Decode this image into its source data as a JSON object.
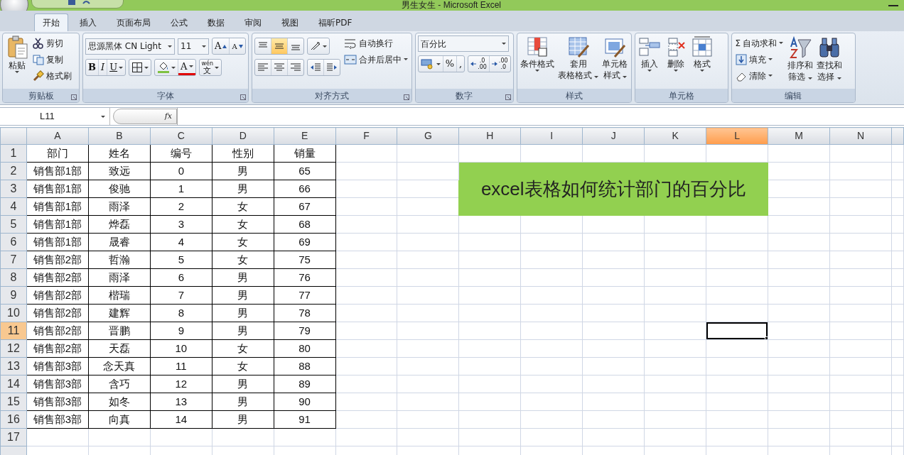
{
  "window": {
    "title": "男生女生 - Microsoft Excel"
  },
  "tabs": [
    {
      "label": "开始",
      "selected": true
    },
    {
      "label": "插入",
      "selected": false
    },
    {
      "label": "页面布局",
      "selected": false
    },
    {
      "label": "公式",
      "selected": false
    },
    {
      "label": "数据",
      "selected": false
    },
    {
      "label": "审阅",
      "selected": false
    },
    {
      "label": "视图",
      "selected": false
    },
    {
      "label": "福昕PDF",
      "selected": false
    }
  ],
  "ribbon": [
    {
      "label": "剪贴板",
      "launcher": true,
      "sections": [
        [
          {
            "kind": "paste",
            "label_lines": [
              "粘贴"
            ],
            "caret": true
          }
        ],
        [
          {
            "kind": "cut",
            "label": "剪切",
            "caret": false
          },
          {
            "kind": "copy",
            "label": "复制",
            "caret": false
          },
          {
            "kind": "painter",
            "label": "格式刷",
            "caret": false
          }
        ]
      ]
    },
    {
      "label": "字体",
      "launcher": true,
      "sections": [
        [
          {
            "kind": "row",
            "items": [
              {
                "kind": "fontname",
                "value": "思源黑体 CN Light"
              },
              {
                "kind": "fontsize",
                "value": "11"
              },
              {
                "kind": "tools",
                "buttons": [
                  {
                    "kind": "grow",
                    "text": "A",
                    "caret": false
                  },
                  {
                    "kind": "shrink",
                    "text": "A",
                    "caret": false
                  }
                ]
              }
            ]
          },
          {
            "kind": "row",
            "items": [
              {
                "kind": "tools",
                "buttons": [
                  {
                    "kind": "bold",
                    "text": "B",
                    "caret": false
                  },
                  {
                    "kind": "italic",
                    "text": "I",
                    "caret": false
                  },
                  {
                    "kind": "underline",
                    "text": "U",
                    "caret": true
                  }
                ]
              },
              {
                "kind": "tools",
                "buttons": [
                  {
                    "kind": "borders",
                    "caret": true
                  }
                ]
              },
              {
                "kind": "tools",
                "buttons": [
                  {
                    "kind": "fill",
                    "caret": true
                  },
                  {
                    "kind": "fontcolor",
                    "text": "A",
                    "caret": true
                  }
                ]
              },
              {
                "kind": "tools",
                "buttons": [
                  {
                    "kind": "phonetic",
                    "lines": [
                      "wén",
                      "文"
                    ],
                    "caret": true
                  }
                ]
              }
            ]
          }
        ]
      ]
    },
    {
      "label": "对齐方式",
      "launcher": true,
      "sections": [
        [
          {
            "kind": "row",
            "items": [
              {
                "kind": "tools",
                "buttons": [
                  {
                    "kind": "aligntop",
                    "caret": false,
                    "selected": false
                  },
                  {
                    "kind": "alignmiddle",
                    "caret": false,
                    "selected": true
                  },
                  {
                    "kind": "alignbottom",
                    "caret": false,
                    "selected": false
                  }
                ]
              },
              {
                "kind": "tools",
                "buttons": [
                  {
                    "kind": "orientation",
                    "caret": true
                  }
                ]
              }
            ]
          },
          {
            "kind": "row",
            "items": [
              {
                "kind": "tools",
                "buttons": [
                  {
                    "kind": "alignleft",
                    "caret": false,
                    "selected": false
                  },
                  {
                    "kind": "aligncenter",
                    "caret": false,
                    "selected": false
                  },
                  {
                    "kind": "alignright",
                    "caret": false,
                    "selected": false
                  }
                ]
              },
              {
                "kind": "tools",
                "buttons": [
                  {
                    "kind": "outdent",
                    "caret": false
                  },
                  {
                    "kind": "indent",
                    "caret": false
                  }
                ]
              }
            ]
          }
        ],
        [
          {
            "kind": "wrap",
            "label": "自动换行",
            "caret": false
          },
          {
            "kind": "merge",
            "label": "合并后居中",
            "caret": true
          }
        ]
      ]
    },
    {
      "label": "数字",
      "launcher": true,
      "sections": [
        [
          {
            "kind": "numberformat",
            "value": "百分比"
          },
          {
            "kind": "row",
            "items": [
              {
                "kind": "tools",
                "buttons": [
                  {
                    "kind": "currency",
                    "caret": true
                  },
                  {
                    "kind": "percent",
                    "text": "%",
                    "caret": false
                  },
                  {
                    "kind": "comma",
                    "text": ",",
                    "caret": false
                  }
                ]
              },
              {
                "kind": "tools",
                "buttons": [
                  {
                    "kind": "moredecimals",
                    "lines": [
                      ".0",
                      ".00"
                    ],
                    "caret": false
                  },
                  {
                    "kind": "fewerdecimals",
                    "lines": [
                      ".00",
                      ".0"
                    ],
                    "caret": false
                  }
                ]
              }
            ]
          }
        ]
      ]
    },
    {
      "label": "样式",
      "launcher": false,
      "sections": [
        [
          {
            "kind": "conditional",
            "label_lines": [
              "条件格式"
            ],
            "caret": true
          }
        ],
        [
          {
            "kind": "tablestyle",
            "label_lines": [
              "套用",
              "表格格式"
            ],
            "caret": true
          }
        ],
        [
          {
            "kind": "cellstyle",
            "label_lines": [
              "单元格",
              "样式"
            ],
            "caret": true
          }
        ]
      ]
    },
    {
      "label": "单元格",
      "launcher": false,
      "sections": [
        [
          {
            "kind": "insert",
            "label_lines": [
              "插入"
            ],
            "caret": true
          }
        ],
        [
          {
            "kind": "delete",
            "label_lines": [
              "删除"
            ],
            "caret": true
          }
        ],
        [
          {
            "kind": "format",
            "label_lines": [
              "格式"
            ],
            "caret": true
          }
        ]
      ]
    },
    {
      "label": "编辑",
      "launcher": false,
      "sections": [
        [
          {
            "kind": "autosum",
            "glyph": "Σ",
            "label": "自动求和",
            "caret": true
          },
          {
            "kind": "filldown",
            "label": "填充",
            "caret": true
          },
          {
            "kind": "clear",
            "label": "清除",
            "caret": true
          }
        ],
        [
          {
            "kind": "sort",
            "label_lines": [
              "排序和",
              "筛选"
            ],
            "caret": true
          }
        ],
        [
          {
            "kind": "find",
            "label_lines": [
              "查找和",
              "选择"
            ],
            "caret": true
          }
        ]
      ]
    }
  ],
  "formula_bar": {
    "name_box": "L11",
    "fx": "fx"
  },
  "columns": [
    {
      "label": "A",
      "selected": false
    },
    {
      "label": "B",
      "selected": false
    },
    {
      "label": "C",
      "selected": false
    },
    {
      "label": "D",
      "selected": false
    },
    {
      "label": "E",
      "selected": false
    },
    {
      "label": "F",
      "selected": false
    },
    {
      "label": "G",
      "selected": false
    },
    {
      "label": "H",
      "selected": false
    },
    {
      "label": "I",
      "selected": false
    },
    {
      "label": "J",
      "selected": false
    },
    {
      "label": "K",
      "selected": false
    },
    {
      "label": "L",
      "selected": true
    },
    {
      "label": "M",
      "selected": false
    },
    {
      "label": "N",
      "selected": false
    }
  ],
  "rows": [
    {
      "header": "1",
      "selected": false,
      "cells": [
        "部门",
        "姓名",
        "编号",
        "性别",
        "销量"
      ]
    },
    {
      "header": "2",
      "selected": false,
      "cells": [
        "销售部1部",
        "致远",
        "0",
        "男",
        "65"
      ]
    },
    {
      "header": "3",
      "selected": false,
      "cells": [
        "销售部1部",
        "俊驰",
        "1",
        "男",
        "66"
      ]
    },
    {
      "header": "4",
      "selected": false,
      "cells": [
        "销售部1部",
        "雨泽",
        "2",
        "女",
        "67"
      ]
    },
    {
      "header": "5",
      "selected": false,
      "cells": [
        "销售部1部",
        "烨磊",
        "3",
        "女",
        "68"
      ]
    },
    {
      "header": "6",
      "selected": false,
      "cells": [
        "销售部1部",
        "晟睿",
        "4",
        "女",
        "69"
      ]
    },
    {
      "header": "7",
      "selected": false,
      "cells": [
        "销售部2部",
        "哲瀚",
        "5",
        "女",
        "75"
      ]
    },
    {
      "header": "8",
      "selected": false,
      "cells": [
        "销售部2部",
        "雨泽",
        "6",
        "男",
        "76"
      ]
    },
    {
      "header": "9",
      "selected": false,
      "cells": [
        "销售部2部",
        "楷瑞",
        "7",
        "男",
        "77"
      ]
    },
    {
      "header": "10",
      "selected": false,
      "cells": [
        "销售部2部",
        "建辉",
        "8",
        "男",
        "78"
      ]
    },
    {
      "header": "11",
      "selected": true,
      "cells": [
        "销售部2部",
        "晋鹏",
        "9",
        "男",
        "79"
      ]
    },
    {
      "header": "12",
      "selected": false,
      "cells": [
        "销售部2部",
        "天磊",
        "10",
        "女",
        "80"
      ]
    },
    {
      "header": "13",
      "selected": false,
      "cells": [
        "销售部3部",
        "念天真",
        "11",
        "女",
        "88"
      ]
    },
    {
      "header": "14",
      "selected": false,
      "cells": [
        "销售部3部",
        "含巧",
        "12",
        "男",
        "89"
      ]
    },
    {
      "header": "15",
      "selected": false,
      "cells": [
        "销售部3部",
        "如冬",
        "13",
        "男",
        "90"
      ]
    },
    {
      "header": "16",
      "selected": false,
      "cells": [
        "销售部3部",
        "向真",
        "14",
        "男",
        "91"
      ]
    },
    {
      "header": "17",
      "selected": false
    }
  ],
  "banner": {
    "text": "excel表格如何统计部门的百分比"
  }
}
